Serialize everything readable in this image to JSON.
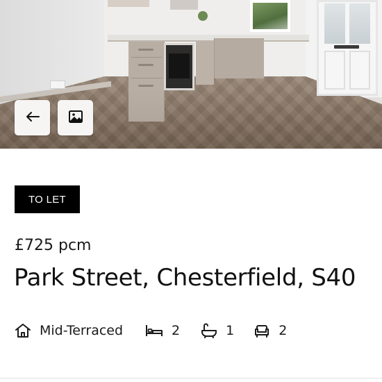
{
  "listing": {
    "status": "TO LET",
    "price": "£725 pcm",
    "address": "Park Street, Chesterfield, S40",
    "property_type": "Mid-Terraced",
    "bedrooms": "2",
    "bathrooms": "1",
    "receptions": "2"
  },
  "hero": {
    "back_icon": "arrow-left-icon",
    "gallery_icon": "image-icon"
  },
  "icons": {
    "property_type": "house-icon",
    "bedrooms": "bed-icon",
    "bathrooms": "bath-icon",
    "receptions": "sofa-icon"
  },
  "colors": {
    "badge_bg": "#000000",
    "badge_text": "#ffffff",
    "text": "#1a1a1a"
  }
}
